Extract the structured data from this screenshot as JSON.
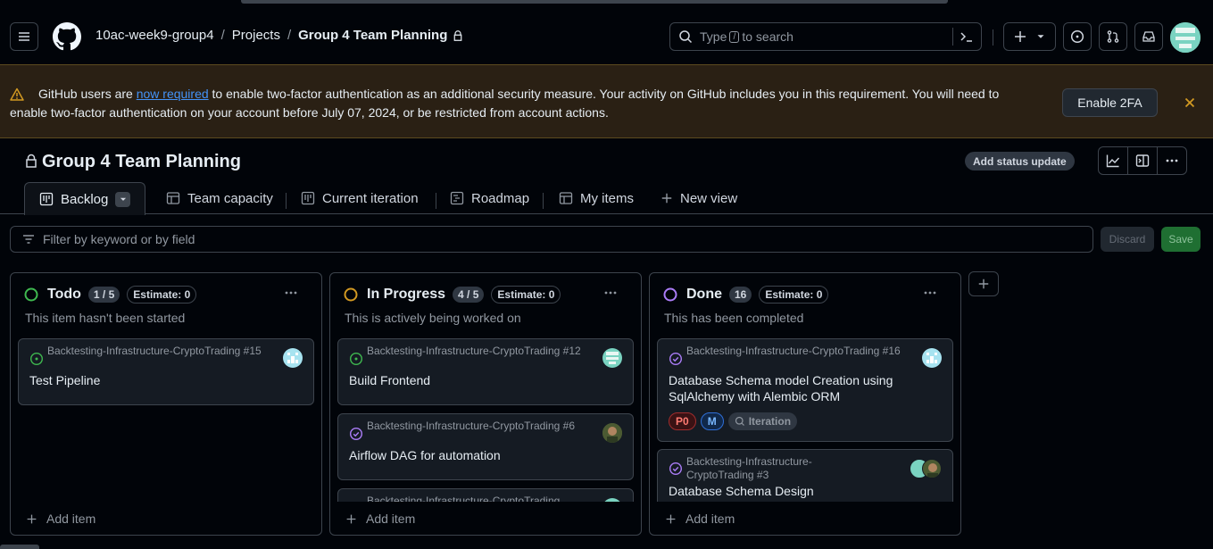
{
  "header": {
    "org": "10ac-week9-group4",
    "projects": "Projects",
    "project": "Group 4 Team Planning",
    "separator": "/",
    "search_pre": "Type",
    "search_key": "/",
    "search_post": "to search"
  },
  "banner": {
    "pre": "GitHub users are",
    "link": "now required",
    "post": "to enable two-factor authentication as an additional security measure. Your activity on GitHub includes you in this requirement. You will need to enable two-factor authentication on your account before July 07, 2024, or be restricted from account actions.",
    "button": "Enable 2FA"
  },
  "project": {
    "title": "Group 4 Team Planning",
    "status_button": "Add status update"
  },
  "tabs": [
    {
      "label": "Backlog"
    },
    {
      "label": "Team capacity"
    },
    {
      "label": "Current iteration"
    },
    {
      "label": "Roadmap"
    },
    {
      "label": "My items"
    },
    {
      "label": "New view"
    }
  ],
  "filter": {
    "placeholder": "Filter by keyword or by field",
    "discard": "Discard",
    "save": "Save"
  },
  "columns": [
    {
      "name": "Todo",
      "count": "1 / 5",
      "estimate": "Estimate: 0",
      "description": "This item hasn't been started",
      "color": "#3fb950",
      "add_item": "Add item",
      "cards": [
        {
          "repo": "Backtesting-Infrastructure-CryptoTrading #15",
          "title": "Test Pipeline"
        }
      ]
    },
    {
      "name": "In Progress",
      "count": "4 / 5",
      "estimate": "Estimate: 0",
      "description": "This is actively being worked on",
      "color": "#d29922",
      "add_item": "Add item",
      "cards": [
        {
          "repo": "Backtesting-Infrastructure-CryptoTrading #12",
          "title": "Build Frontend"
        },
        {
          "repo": "Backtesting-Infrastructure-CryptoTrading #6",
          "title": "Airflow DAG for automation"
        },
        {
          "repo": "Backtesting-Infrastructure-CryptoTrading",
          "title": ""
        }
      ]
    },
    {
      "name": "Done",
      "count": "16",
      "estimate": "Estimate: 0",
      "description": "This has been completed",
      "color": "#ab7df8",
      "add_item": "Add item",
      "cards": [
        {
          "repo": "Backtesting-Infrastructure-CryptoTrading #16",
          "title": "Database Schema model Creation using SqlAlchemy with Alembic ORM",
          "labels": [
            "P0",
            "M",
            "Iteration"
          ]
        },
        {
          "repo": "Backtesting-Infrastructure-CryptoTrading #3",
          "title": "Database Schema Design"
        }
      ]
    }
  ]
}
